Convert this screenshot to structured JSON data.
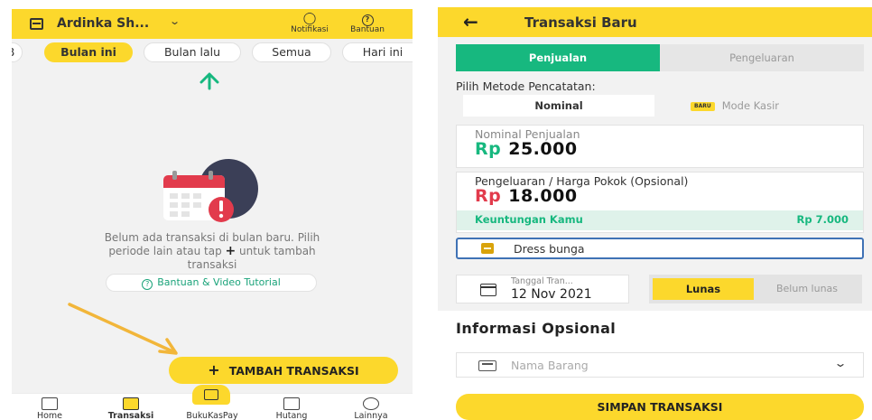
{
  "left_screen": {
    "header": {
      "shop_name": "Ardinka Sh...",
      "notifications_label": "Notifikasi",
      "help_label": "Bantuan"
    },
    "filters": [
      {
        "label": "B",
        "active": false
      },
      {
        "label": "Bulan ini",
        "active": true
      },
      {
        "label": "Bulan lalu",
        "active": false
      },
      {
        "label": "Semua",
        "active": false
      },
      {
        "label": "Hari ini",
        "active": false
      }
    ],
    "empty_state": {
      "line1": "Belum ada transaksi di bulan baru. Pilih",
      "line2_before": "periode lain atau tap ",
      "line2_plus": "+",
      "line2_after": " untuk tambah",
      "line3": "transaksi"
    },
    "tutorial_button": "Bantuan & Video Tutorial",
    "fab_label": "TAMBAH TRANSAKSI",
    "fab_plus": "+",
    "bottom_nav": [
      {
        "label": "Home",
        "icon": "home-icon",
        "active": false
      },
      {
        "label": "Transaksi",
        "icon": "transaction-icon",
        "active": true
      },
      {
        "label": "BukuKasPay",
        "icon": "card-icon",
        "active": false
      },
      {
        "label": "Hutang",
        "icon": "debt-icon",
        "active": false
      },
      {
        "label": "Lainnya",
        "icon": "more-icon",
        "active": false
      }
    ],
    "colors": {
      "accent": "#fcd82c",
      "green": "#1aa37a",
      "annotation_arrow": "#f2b63a"
    }
  },
  "right_screen": {
    "header": {
      "title": "Transaksi Baru"
    },
    "type_tabs": [
      {
        "label": "Penjualan",
        "active": true
      },
      {
        "label": "Pengeluaran",
        "active": false
      }
    ],
    "method_label": "Pilih Metode Pencatatan:",
    "method_tabs": {
      "nominal": "Nominal",
      "kasir_badge": "BARU",
      "kasir": "Mode Kasir"
    },
    "sales": {
      "label": "Nominal Penjualan",
      "currency": "Rp",
      "amount": "25.000"
    },
    "cost": {
      "label": "Pengeluaran / Harga Pokok (Opsional)",
      "currency": "Rp",
      "amount": "18.000"
    },
    "profit": {
      "label": "Keuntungan Kamu",
      "value": "Rp 7.000"
    },
    "note": {
      "value": "Dress bunga"
    },
    "date": {
      "label": "Tanggal Tran...",
      "value": "12 Nov 2021"
    },
    "status": {
      "paid": "Lunas",
      "unpaid": "Belum lunas",
      "selected": "paid"
    },
    "optional": {
      "title": "Informasi Opsional",
      "item_placeholder": "Nama Barang"
    },
    "save_label": "SIMPAN TRANSAKSI",
    "colors": {
      "green": "#17b87f",
      "red": "#e23b4c",
      "accent": "#fcd82c",
      "focus": "#3f72b5"
    }
  }
}
